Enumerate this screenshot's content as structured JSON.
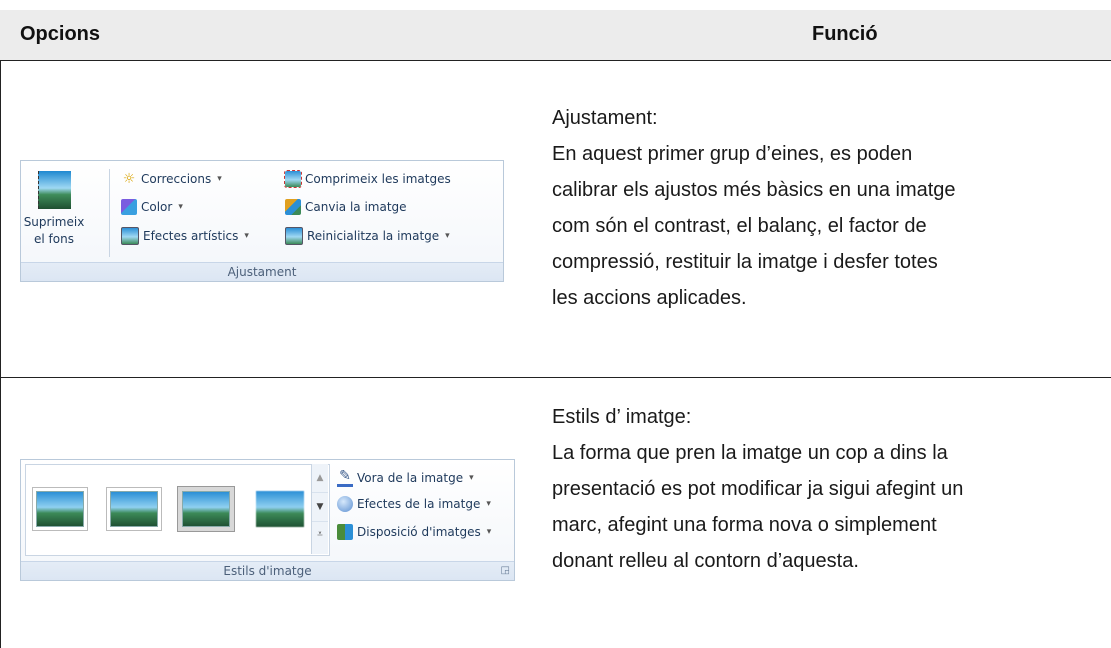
{
  "header": {
    "col1": "Opcions",
    "col2": "Funció"
  },
  "row1": {
    "ribbon": {
      "big_button_line1": "Suprimeix",
      "big_button_line2": "el fons",
      "items": [
        "Correccions",
        "Color",
        "Efectes artístics",
        "Comprimeix les imatges",
        "Canvia la imatge",
        "Reinicialitza la imatge"
      ],
      "group_label": "Ajustament"
    },
    "title": "Ajustament:",
    "lines": [
      "En aquest primer grup d’eines, es poden",
      "calibrar els ajustos més bàsics en una imatge",
      "com són el contrast, el balanç, el factor de",
      "compressió, restituir la imatge i desfer totes",
      "les accions aplicades."
    ]
  },
  "row2": {
    "ribbon": {
      "items": [
        "Vora de la imatge",
        "Efectes de la imatge",
        "Disposició d'imatges"
      ],
      "group_label": "Estils d'imatge"
    },
    "title": "Estils d’ imatge:",
    "lines": [
      "La forma que pren la imatge un cop a dins la",
      "presentació es pot modificar ja sigui afegint un",
      "marc, afegint una forma nova o simplement",
      "donant relleu al contorn d’aquesta."
    ]
  },
  "colors": {
    "header_bg": "#ececec",
    "ribbon_border": "#b9c9da",
    "ribbon_text": "#1e395b"
  }
}
